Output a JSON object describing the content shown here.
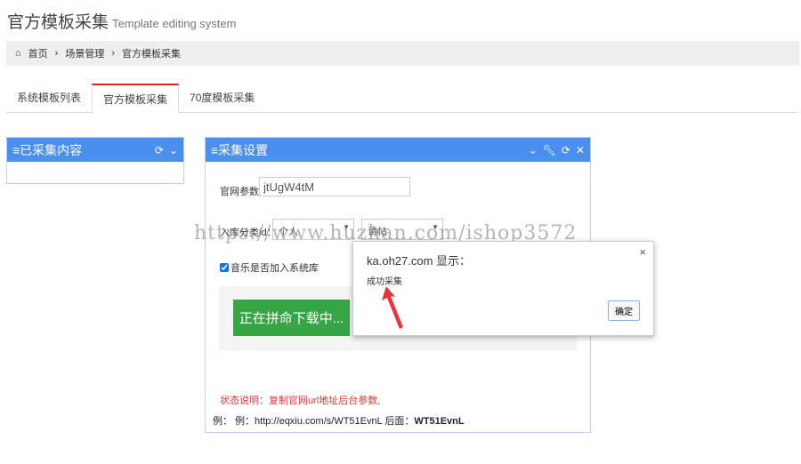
{
  "header": {
    "title": "官方模板采集",
    "subtitle": "Template editing system"
  },
  "breadcrumb": [
    "首页",
    "场景管理",
    "官方模板采集"
  ],
  "tabs": [
    "系统模板列表",
    "官方模板采集",
    "70度模板采集"
  ],
  "left_panel": {
    "title": "已采集内容"
  },
  "settings_panel": {
    "title": "采集设置",
    "param_label": "官网参数:",
    "param_value": "jtUgW4tM",
    "category_label": "入库分类id：",
    "category_value": "个人",
    "category_value2": "请帖",
    "music_label": "音乐是否加入系统库",
    "download_button": "正在拼命下载中...",
    "status_note": "状态说明：复制官网url地址后台参数,",
    "example": "例： 例：http://eqxiu.com/s/WT51EvnL 后面：",
    "example_bold": "WT51EvnL"
  },
  "dialog": {
    "title": "ka.oh27.com 显示：",
    "message": "成功采集",
    "ok": "确定",
    "close": "×"
  },
  "watermark": "https://www.huzhan.com/ishop3572",
  "colors": {
    "accent": "#4a8ef0",
    "active_tab": "#d9261c",
    "green": "#37a546",
    "note": "#e8333a"
  }
}
